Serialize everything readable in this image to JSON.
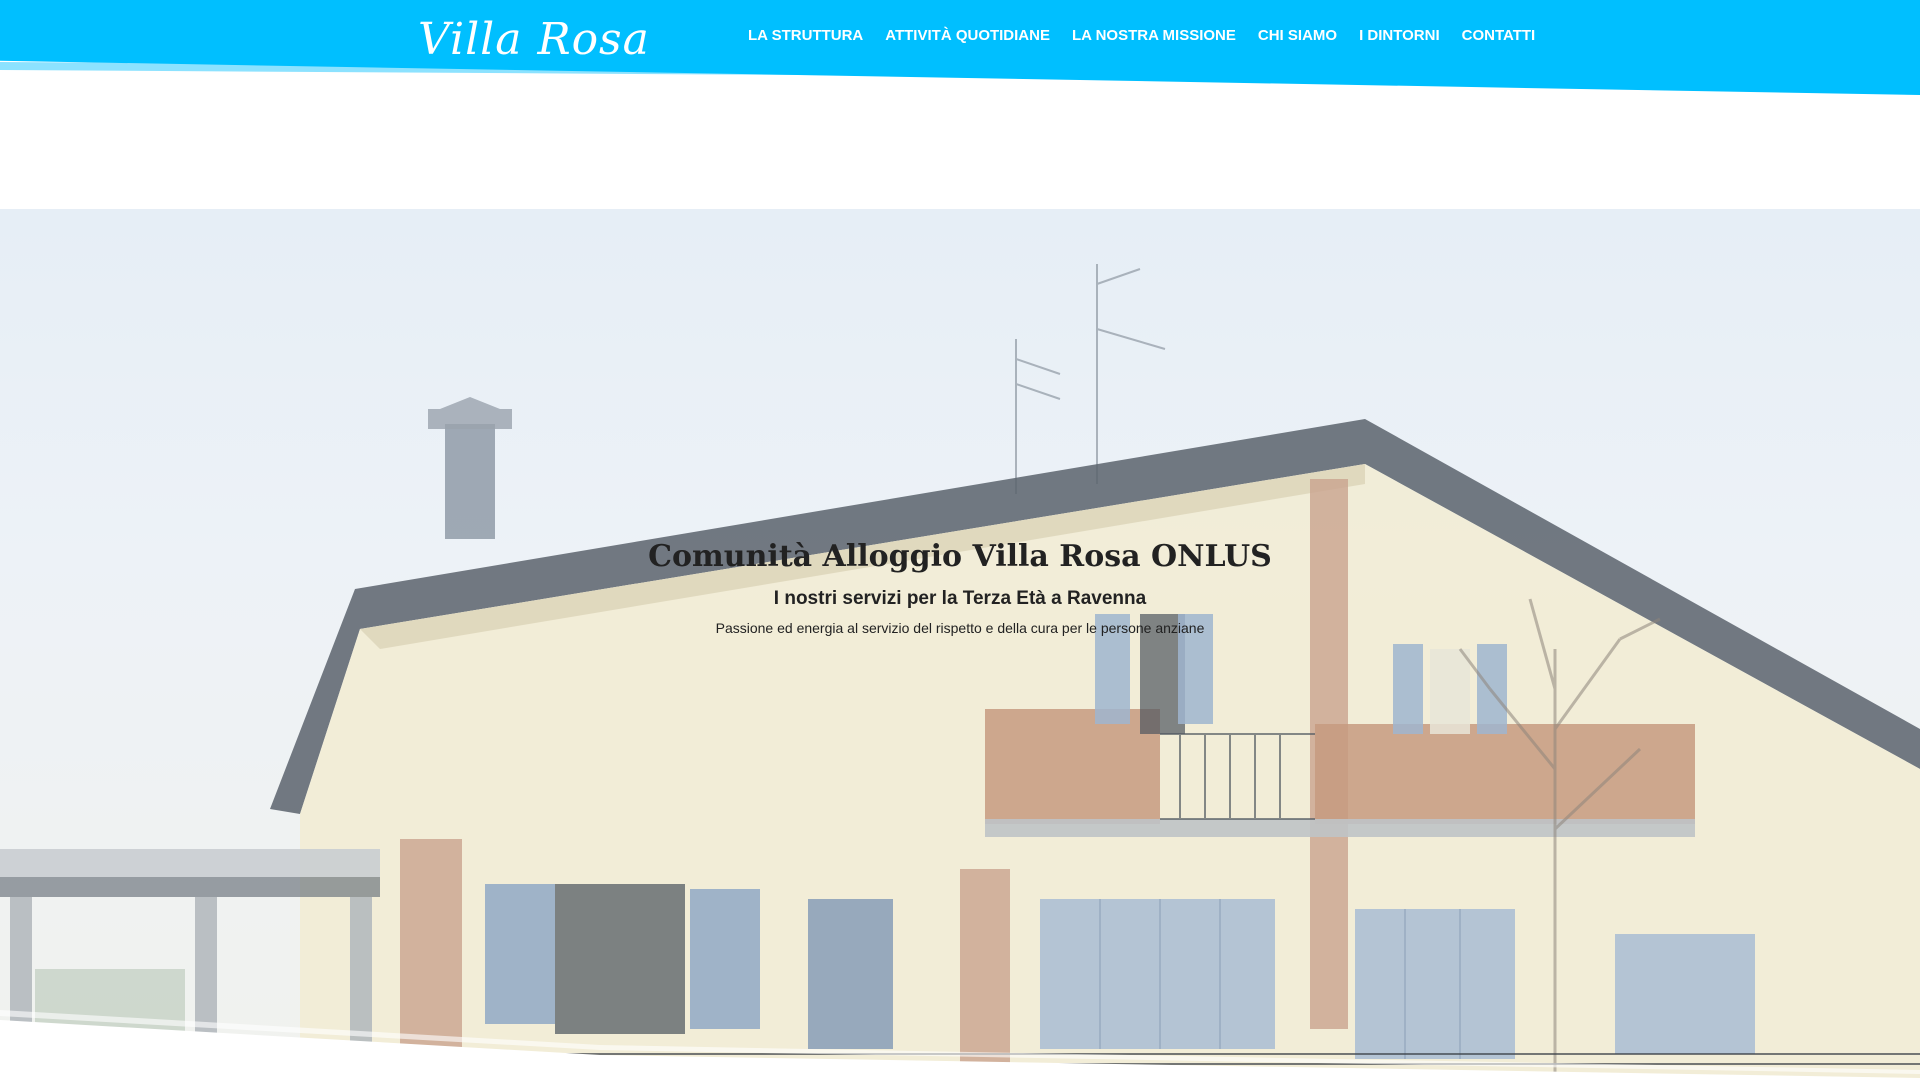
{
  "brand": {
    "logo_text": "Villa Rosa"
  },
  "nav": {
    "items": [
      {
        "label": "LA STRUTTURA"
      },
      {
        "label": "ATTIVITÀ QUOTIDIANE"
      },
      {
        "label": "LA NOSTRA MISSIONE"
      },
      {
        "label": "CHI SIAMO"
      },
      {
        "label": "I DINTORNI"
      },
      {
        "label": "CONTATTI"
      }
    ]
  },
  "hero": {
    "title": "Comunità Alloggio Villa Rosa ONLUS",
    "subtitle": "I nostri servizi per la Terza Età a Ravenna",
    "tagline": "Passione ed energia al servizio del rispetto e della cura per le persone anziane"
  },
  "colors": {
    "header_bg": "#00bfff",
    "text_dark": "#222222"
  }
}
